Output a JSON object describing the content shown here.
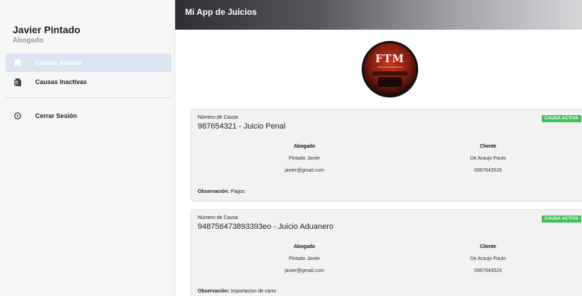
{
  "user": {
    "name": "Javier Pintado",
    "role": "Abogado"
  },
  "nav": [
    {
      "label": "Causas Activas",
      "icon": "bookmark-icon",
      "active": true
    },
    {
      "label": "Causas Inactivas",
      "icon": "document-icon",
      "active": false
    }
  ],
  "logout": {
    "label": "Cerrar Sesión",
    "icon": "logout-icon"
  },
  "app": {
    "title": "Mi App de Juicios"
  },
  "logo": {
    "text": "FTM",
    "sub": "ABOGADOS ASOCIADOS"
  },
  "colors": {
    "accent": "#3fc05a",
    "active_nav": "#dde5f3"
  },
  "cases": [
    {
      "number_label": "Número de Causa",
      "title": "987654321 - Juicio Penal",
      "status": "CAUSA ACTIVA",
      "lawyer_header": "Abogado",
      "lawyer_name": "Pintado Javier",
      "lawyer_email": "javier@gmail.com",
      "client_header": "Cliente",
      "client_name": "De Araujo Paulo",
      "client_phone": "0987643526",
      "obs_label": "Observación:",
      "obs_text": "Pagos"
    },
    {
      "number_label": "Número de Causa",
      "title": "948756473893393eo - Juicio Aduanero",
      "status": "CAUSA ACTIVA",
      "lawyer_header": "Abogado",
      "lawyer_name": "Pintado Javier",
      "lawyer_email": "javier@gmail.com",
      "client_header": "Cliente",
      "client_name": "De Araujo Paulo",
      "client_phone": "0987643526",
      "obs_label": "Observación:",
      "obs_text": "Importacion de carro"
    }
  ]
}
